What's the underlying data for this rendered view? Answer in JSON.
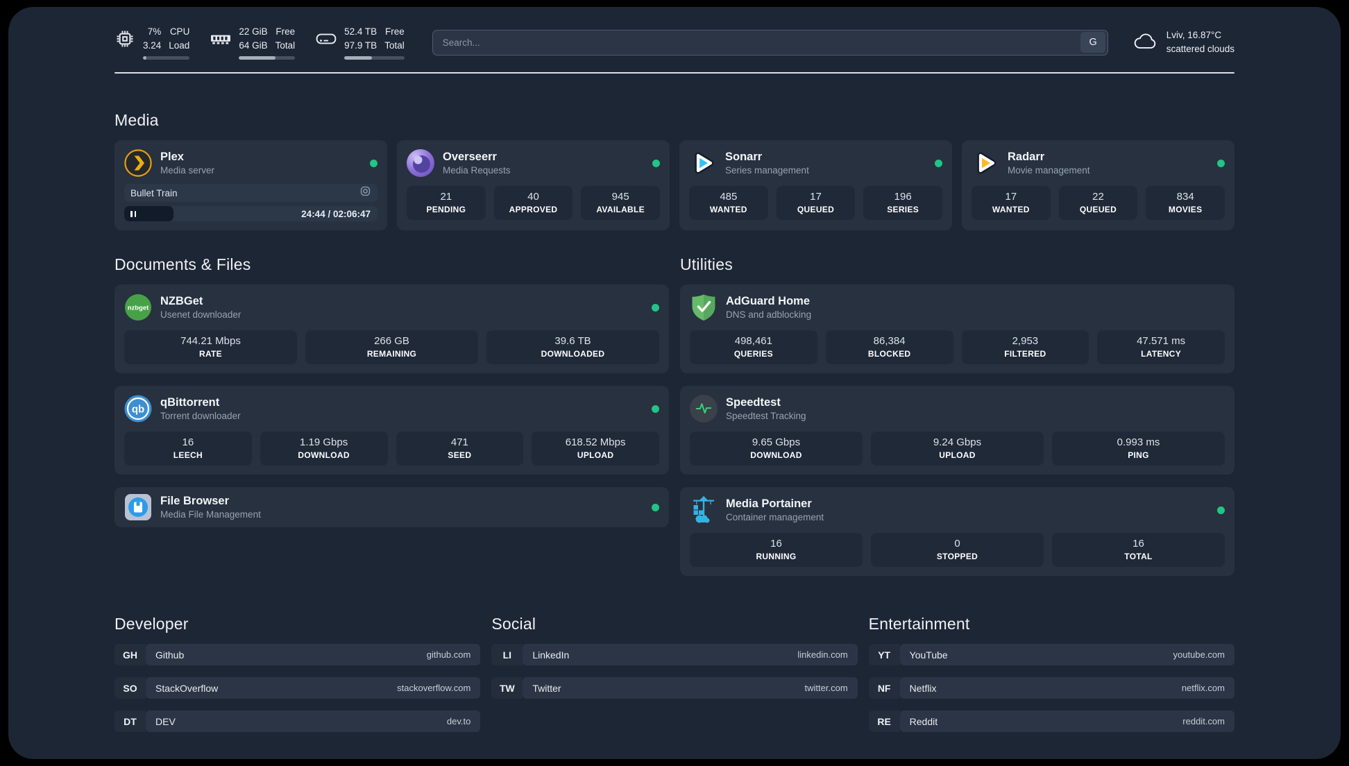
{
  "topbar": {
    "stats": [
      {
        "icon": "cpu-icon",
        "value_top": "7%",
        "value_bottom": "3.24",
        "label_top": "CPU",
        "label_bottom": "Load",
        "progress_percent": 7
      },
      {
        "icon": "memory-icon",
        "value_top": "22 GiB",
        "value_bottom": "64 GiB",
        "label_top": "Free",
        "label_bottom": "Total",
        "progress_percent": 65
      },
      {
        "icon": "disk-icon",
        "value_top": "52.4 TB",
        "value_bottom": "97.9 TB",
        "label_top": "Free",
        "label_bottom": "Total",
        "progress_percent": 46
      }
    ],
    "search": {
      "placeholder": "Search...",
      "button_label": "G"
    },
    "weather": {
      "icon": "cloud-icon",
      "line1": "Lviv, 16.87°C",
      "line2": "scattered clouds"
    }
  },
  "sections": {
    "media": {
      "title": "Media",
      "plex": {
        "name": "Plex",
        "description": "Media server",
        "status": "online",
        "player": {
          "now_playing": "Bullet Train",
          "time_display": "24:44 / 02:06:47",
          "progress_percent": 19.5
        }
      },
      "overseerr": {
        "name": "Overseerr",
        "description": "Media Requests",
        "status": "online",
        "stats": [
          {
            "value": "21",
            "label": "PENDING"
          },
          {
            "value": "40",
            "label": "APPROVED"
          },
          {
            "value": "945",
            "label": "AVAILABLE"
          }
        ]
      },
      "sonarr": {
        "name": "Sonarr",
        "description": "Series management",
        "status": "online",
        "stats": [
          {
            "value": "485",
            "label": "WANTED"
          },
          {
            "value": "17",
            "label": "QUEUED"
          },
          {
            "value": "196",
            "label": "SERIES"
          }
        ]
      },
      "radarr": {
        "name": "Radarr",
        "description": "Movie management",
        "status": "online",
        "stats": [
          {
            "value": "17",
            "label": "WANTED"
          },
          {
            "value": "22",
            "label": "QUEUED"
          },
          {
            "value": "834",
            "label": "MOVIES"
          }
        ]
      }
    },
    "documents": {
      "title": "Documents & Files",
      "nzbget": {
        "name": "NZBGet",
        "description": "Usenet downloader",
        "status": "online",
        "stats": [
          {
            "value": "744.21 Mbps",
            "label": "RATE"
          },
          {
            "value": "266 GB",
            "label": "REMAINING"
          },
          {
            "value": "39.6 TB",
            "label": "DOWNLOADED"
          }
        ]
      },
      "qbittorrent": {
        "name": "qBittorrent",
        "description": "Torrent downloader",
        "status": "online",
        "stats": [
          {
            "value": "16",
            "label": "LEECH"
          },
          {
            "value": "1.19 Gbps",
            "label": "DOWNLOAD"
          },
          {
            "value": "471",
            "label": "SEED"
          },
          {
            "value": "618.52 Mbps",
            "label": "UPLOAD"
          }
        ]
      },
      "filebrowser": {
        "name": "File Browser",
        "description": "Media File Management",
        "status": "online"
      }
    },
    "utilities": {
      "title": "Utilities",
      "adguard": {
        "name": "AdGuard Home",
        "description": "DNS and adblocking",
        "stats": [
          {
            "value": "498,461",
            "label": "QUERIES"
          },
          {
            "value": "86,384",
            "label": "BLOCKED"
          },
          {
            "value": "2,953",
            "label": "FILTERED"
          },
          {
            "value": "47.571 ms",
            "label": "LATENCY"
          }
        ]
      },
      "speedtest": {
        "name": "Speedtest",
        "description": "Speedtest Tracking",
        "stats": [
          {
            "value": "9.65 Gbps",
            "label": "DOWNLOAD"
          },
          {
            "value": "9.24 Gbps",
            "label": "UPLOAD"
          },
          {
            "value": "0.993 ms",
            "label": "PING"
          }
        ]
      },
      "portainer": {
        "name": "Media Portainer",
        "description": "Container management",
        "status": "online",
        "stats": [
          {
            "value": "16",
            "label": "RUNNING"
          },
          {
            "value": "0",
            "label": "STOPPED"
          },
          {
            "value": "16",
            "label": "TOTAL"
          }
        ]
      }
    },
    "developer": {
      "title": "Developer",
      "links": [
        {
          "abbr": "GH",
          "name": "Github",
          "url": "github.com"
        },
        {
          "abbr": "SO",
          "name": "StackOverflow",
          "url": "stackoverflow.com"
        },
        {
          "abbr": "DT",
          "name": "DEV",
          "url": "dev.to"
        }
      ]
    },
    "social": {
      "title": "Social",
      "links": [
        {
          "abbr": "LI",
          "name": "LinkedIn",
          "url": "linkedin.com"
        },
        {
          "abbr": "TW",
          "name": "Twitter",
          "url": "twitter.com"
        }
      ]
    },
    "entertainment": {
      "title": "Entertainment",
      "links": [
        {
          "abbr": "YT",
          "name": "YouTube",
          "url": "youtube.com"
        },
        {
          "abbr": "NF",
          "name": "Netflix",
          "url": "netflix.com"
        },
        {
          "abbr": "RE",
          "name": "Reddit",
          "url": "reddit.com"
        }
      ]
    }
  },
  "colors": {
    "page_bg": "#1d2635",
    "card_bg": "#27313f",
    "stat_bg": "#1f2938",
    "status_online": "#21c585",
    "plex_amber": "#e5a00d",
    "sonarr_blue": "#35c3f1",
    "radarr_yellow": "#fdb924",
    "adguard_green": "#66bb6a",
    "portainer_blue": "#33b3e3"
  }
}
